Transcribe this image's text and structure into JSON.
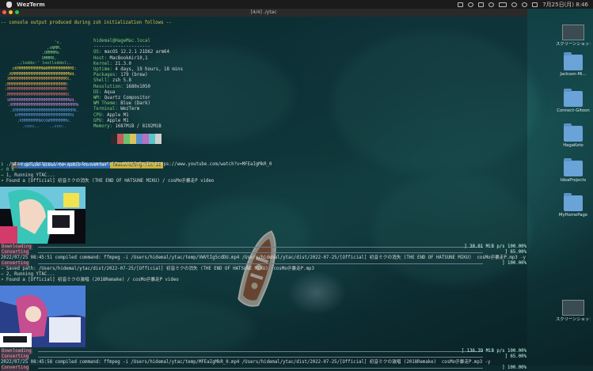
{
  "menubar": {
    "app_name": "WezTerm",
    "datetime": "7月25日(月) 8:46"
  },
  "window": {
    "title": "[4/4] ./ytac"
  },
  "terminal": {
    "console_notice": "-- console output produced during zsh initialization follows --",
    "neofetch_art": [
      "                    'c.",
      "                 ,xNMM.",
      "               .OMMMMo",
      "               OMMM0,",
      "     .;loddo:' loolloddol;.",
      "   cKMMMMMMMMMMNWMMMMMMMMMM0:",
      " .KMMMMMMMMMMMMMMMMMMMMMMMWd.",
      " XMMMMMMMMMMMMMMMMMMMMMMMX.",
      ";MMMMMMMMMMMMMMMMMMMMMMMM:",
      ":MMMMMMMMMMMMMMMMMMMMMMMM:",
      ".MMMMMMMMMMMMMMMMMMMMMMMMX.",
      " kMMMMMMMMMMMMMMMMMMMMMMMMWd.",
      " .XMMMMMMMMMMMMMMMMMMMMMMMMMMk",
      "  .XMMMMMMMMMMMMMMMMMMMMMMMMK.",
      "    kMMMMMMMMMMMMMMMMMMMMMMd",
      "     ;KMMMMMMMWXXWMMMMMMMk.",
      "       .cooc,.    .,coo:."
    ],
    "sysinfo": [
      {
        "key": "",
        "value": "hidemal@HageMac.local"
      },
      {
        "key": "",
        "value": "---------------------"
      },
      {
        "key": "OS:",
        "value": " macOS 12.2.1 21D62 arm64"
      },
      {
        "key": "Host:",
        "value": " MacBookAir10,1"
      },
      {
        "key": "Kernel:",
        "value": " 21.3.0"
      },
      {
        "key": "Uptime:",
        "value": " 4 days, 19 hours, 18 mins"
      },
      {
        "key": "Packages:",
        "value": " 179 (brew)"
      },
      {
        "key": "Shell:",
        "value": " zsh 5.8"
      },
      {
        "key": "Resolution:",
        "value": " 1680x1050"
      },
      {
        "key": "DE:",
        "value": " Aqua"
      },
      {
        "key": "WM:",
        "value": " Quartz Compositor"
      },
      {
        "key": "WM Theme:",
        "value": " Blue (Dark)"
      },
      {
        "key": "Terminal:",
        "value": " WezTerm"
      },
      {
        "key": "CPU:",
        "value": " Apple M1"
      },
      {
        "key": "GPU:",
        "value": " Apple M1"
      },
      {
        "key": "Memory:",
        "value": " 1687MiB / 8192MiB"
      }
    ],
    "palette": [
      "#2b2b2b",
      "#c75a5a",
      "#6fbf6f",
      "#d9c35a",
      "#5b8fd1",
      "#b86fc4",
      "#5cc3c9",
      "#d0d0d0"
    ],
    "prompt": {
      "dir": "YouTube-Video-to-Audio-converter",
      "branch": "feature/bug-fix 11"
    },
    "command": "./ytac get https://www.youtube.com/watch?v=VWVtIg5cdDU https://www.youtube.com/watch?v=MFEaIgMkR_0",
    "ok1": "✓ 0 K",
    "step1": "1, Running YTAC...",
    "found1": "Found a [Official] 初音ミクの消失 (THE END OF HATSUNE MIKU) / cosMo＠暴走P video",
    "dl1_label": "Downloading",
    "dl1_value": "] 30.01 MiB p/s 100.00%",
    "conv1_label": "Converting",
    "conv1_value": "] 65.00%",
    "compiled1": "2022/07/25 08:45:51 compiled command: ffmpeg -i /Users/hidemal/ytac/temp/VWVtIg5cdDU.mp4 /Users/hidemal/ytac/dist/2022-07-25/[Official] 初音ミクの消失 (THE END OF HATSUNE MIKU)  cosMo＠暴走P.mp3 -y",
    "conv1b_label": "Converting",
    "conv1b_value": "] 100.00%",
    "saved1": "Saved path: /Users/hidemal/ytac/dist/2022-07-25/[Official] 初音ミクの消失 (THE END OF HATSUNE MIKU)  cosMo＠暴走P.mp3",
    "step2": "2, Running YTAC...",
    "found2": "Found a [Official] 初音ミクの激唱 (2018Remake) / cosMo＠暴走P video",
    "dl2_label": "Downloading",
    "dl2_value": "] 136.39 MiB p/s 100.00%",
    "conv2_label": "Converting",
    "conv2_value": "] 65.00%",
    "compiled2": "2022/07/25 08:45:58 compiled command: ffmpeg -i /Users/hidemal/ytac/temp/MFEaIgMkR_0.mp4 /Users/hidemal/ytac/dist/2022-07-25/[Official] 初音ミクの激唱 (2018Remake)  cosMo＠暴走P.mp3 -y",
    "conv2b_label": "Converting",
    "conv2b_value": "] 100.00%"
  },
  "desktop": {
    "icons": [
      {
        "label": "スクリーンショット 2022-07-...8.38.48",
        "kind": "screenshot"
      },
      {
        "label": "Jackson-Mi...",
        "kind": "folder"
      },
      {
        "label": "Connect-Gitoon",
        "kind": "folder"
      },
      {
        "label": "HagaKoto",
        "kind": "folder"
      },
      {
        "label": "IdeaProjects",
        "kind": "folder"
      },
      {
        "label": "MyHomePage",
        "kind": "folder"
      },
      {
        "label": "スクリーンショット 2022-07-...2.06.24",
        "kind": "screenshot"
      }
    ]
  }
}
